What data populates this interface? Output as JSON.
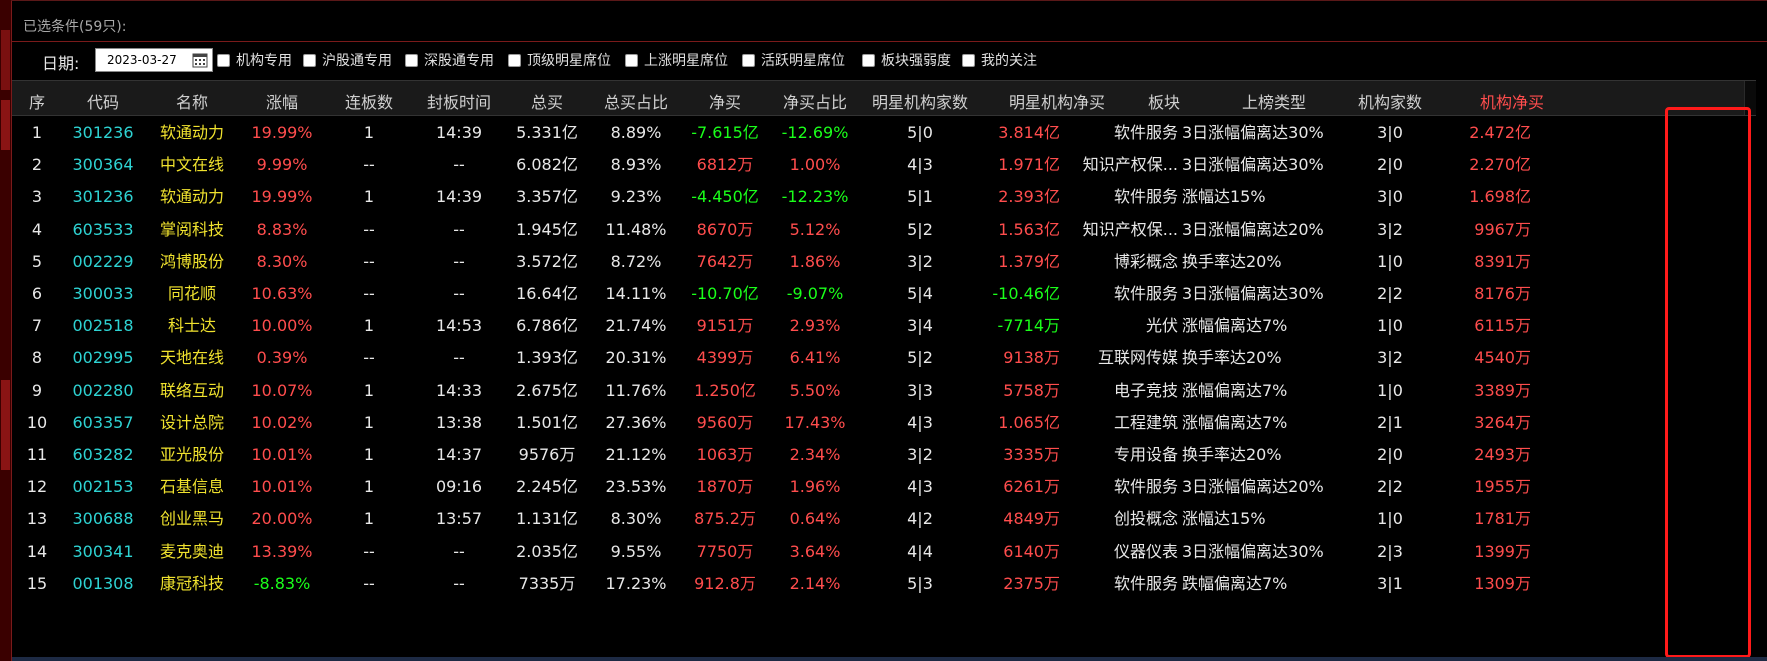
{
  "conditions": {
    "label": "已选条件(59只):"
  },
  "filter_bar": {
    "date_label": "日期:",
    "date_value": "2023-03-27",
    "checkboxes": [
      {
        "label": "机构专用",
        "checked": false
      },
      {
        "label": "沪股通专用",
        "checked": false
      },
      {
        "label": "深股通专用",
        "checked": false
      },
      {
        "label": "顶级明星席位",
        "checked": false
      },
      {
        "label": "上涨明星席位",
        "checked": false
      },
      {
        "label": "活跃明星席位",
        "checked": false
      },
      {
        "label": "板块强弱度",
        "checked": false
      },
      {
        "label": "我的关注",
        "checked": false
      }
    ]
  },
  "table": {
    "columns": [
      "序",
      "代码",
      "名称",
      "涨幅",
      "连板数",
      "封板时间",
      "总买",
      "总买占比",
      "净买",
      "净买占比",
      "明星机构家数",
      "明星机构净买",
      "板块",
      "上榜类型",
      "机构家数",
      "机构净买"
    ],
    "highlighted_column": "机构净买",
    "rows": [
      [
        "1",
        "301236",
        "软通动力",
        "19.99%",
        "1",
        "14:39",
        "5.331亿",
        "8.89%",
        "-7.615亿",
        "-12.69%",
        "5|0",
        "3.814亿",
        "软件服务",
        "3日涨幅偏离达30%",
        "3|0",
        "2.472亿"
      ],
      [
        "2",
        "300364",
        "中文在线",
        "9.99%",
        "--",
        "--",
        "6.082亿",
        "8.93%",
        "6812万",
        "1.00%",
        "4|3",
        "1.971亿",
        "知识产权保...",
        "3日涨幅偏离达30%",
        "2|0",
        "2.270亿"
      ],
      [
        "3",
        "301236",
        "软通动力",
        "19.99%",
        "1",
        "14:39",
        "3.357亿",
        "9.23%",
        "-4.450亿",
        "-12.23%",
        "5|1",
        "2.393亿",
        "软件服务",
        "涨幅达15%",
        "3|0",
        "1.698亿"
      ],
      [
        "4",
        "603533",
        "掌阅科技",
        "8.83%",
        "--",
        "--",
        "1.945亿",
        "11.48%",
        "8670万",
        "5.12%",
        "5|2",
        "1.563亿",
        "知识产权保...",
        "3日涨幅偏离达20%",
        "3|2",
        "9967万"
      ],
      [
        "5",
        "002229",
        "鸿博股份",
        "8.30%",
        "--",
        "--",
        "3.572亿",
        "8.72%",
        "7642万",
        "1.86%",
        "3|2",
        "1.379亿",
        "博彩概念",
        "换手率达20%",
        "1|0",
        "8391万"
      ],
      [
        "6",
        "300033",
        "同花顺",
        "10.63%",
        "--",
        "--",
        "16.64亿",
        "14.11%",
        "-10.70亿",
        "-9.07%",
        "5|4",
        "-10.46亿",
        "软件服务",
        "3日涨幅偏离达30%",
        "2|2",
        "8176万"
      ],
      [
        "7",
        "002518",
        "科士达",
        "10.00%",
        "1",
        "14:53",
        "6.786亿",
        "21.74%",
        "9151万",
        "2.93%",
        "3|4",
        "-7714万",
        "光伏",
        "涨幅偏离达7%",
        "1|0",
        "6115万"
      ],
      [
        "8",
        "002995",
        "天地在线",
        "0.39%",
        "--",
        "--",
        "1.393亿",
        "20.31%",
        "4399万",
        "6.41%",
        "5|2",
        "9138万",
        "互联网传媒",
        "换手率达20%",
        "3|2",
        "4540万"
      ],
      [
        "9",
        "002280",
        "联络互动",
        "10.07%",
        "1",
        "14:33",
        "2.675亿",
        "11.76%",
        "1.250亿",
        "5.50%",
        "3|3",
        "5758万",
        "电子竞技",
        "涨幅偏离达7%",
        "1|0",
        "3389万"
      ],
      [
        "10",
        "603357",
        "设计总院",
        "10.02%",
        "1",
        "13:38",
        "1.501亿",
        "27.36%",
        "9560万",
        "17.43%",
        "4|3",
        "1.065亿",
        "工程建筑",
        "涨幅偏离达7%",
        "2|1",
        "3264万"
      ],
      [
        "11",
        "603282",
        "亚光股份",
        "10.01%",
        "1",
        "14:37",
        "9576万",
        "21.12%",
        "1063万",
        "2.34%",
        "3|2",
        "3335万",
        "专用设备",
        "换手率达20%",
        "2|0",
        "2493万"
      ],
      [
        "12",
        "002153",
        "石基信息",
        "10.01%",
        "1",
        "09:16",
        "2.245亿",
        "23.53%",
        "1870万",
        "1.96%",
        "4|3",
        "6261万",
        "软件服务",
        "3日涨幅偏离达20%",
        "2|2",
        "1955万"
      ],
      [
        "13",
        "300688",
        "创业黑马",
        "20.00%",
        "1",
        "13:57",
        "1.131亿",
        "8.30%",
        "875.2万",
        "0.64%",
        "4|2",
        "4849万",
        "创投概念",
        "涨幅达15%",
        "1|0",
        "1781万"
      ],
      [
        "14",
        "300341",
        "麦克奥迪",
        "13.39%",
        "--",
        "--",
        "2.035亿",
        "9.55%",
        "7750万",
        "3.64%",
        "4|4",
        "6140万",
        "仪器仪表",
        "3日涨幅偏离达30%",
        "2|3",
        "1399万"
      ],
      [
        "15",
        "001308",
        "康冠科技",
        "-8.83%",
        "--",
        "--",
        "7335万",
        "17.23%",
        "912.8万",
        "2.14%",
        "5|3",
        "2375万",
        "软件服务",
        "跌幅偏离达7%",
        "3|1",
        "1309万"
      ]
    ]
  },
  "colors": {
    "code": "#2ed3d3",
    "name": "#f0e22e",
    "up": "#ff4d4d",
    "down": "#1aff1a",
    "neutral": "#e8e8e8",
    "highlight_border": "#ff1a1a"
  }
}
